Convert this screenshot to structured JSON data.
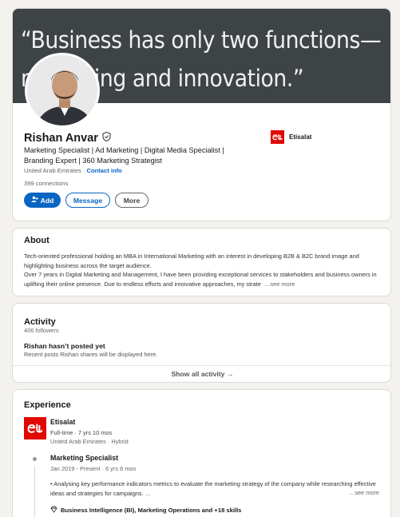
{
  "profile": {
    "banner_line_1": "“Business has only two functions—",
    "banner_line_2": "marketing and innovation.”",
    "name": "Rishan Anvar",
    "headline": "Marketing Specialist | Ad Marketing | Digital Media Specialist | Branding Expert | 360 Marketing Strategist",
    "location": "United Arab Emirates",
    "location_sep": " · ",
    "contact_info": "Contact info",
    "connections": "399 connections",
    "current_company": "Etisalat",
    "buttons": {
      "add": "Add",
      "message": "Message",
      "more": "More"
    }
  },
  "about": {
    "title": "About",
    "text_1": "Tech-oriented professional holding an MBA in International Marketing with an interest in developing B2B & B2C brand image and highlighting business across the target audience.",
    "text_2": "Over 7 years in Digital Marketing and Management, I have been providing exceptional services to stakeholders and business owners in uplifting their online presence. Due to endless efforts and innovative approaches, my strate",
    "see_more": "…see more"
  },
  "activity": {
    "title": "Activity",
    "followers": "406 followers",
    "no_posts_title": "Rishan hasn’t posted yet",
    "no_posts_sub": "Recent posts Rishan shares will be displayed here.",
    "show_all": "Show all activity →"
  },
  "experience": {
    "title": "Experience",
    "company": "Etisalat",
    "employment": "Full-time · 7 yrs 10 mos",
    "location": "United Arab Emirates · Hybrid",
    "role": "Marketing Specialist",
    "dates": "Jan 2019 - Present · 6 yrs 6 mos",
    "description": "• Analysing key performance indicators metrics to evaluate the marketing strategy of the company while researching effective ideas and strategies for campaigns. …",
    "see_more": "…see more",
    "skills": "Business Intelligence (BI), Marketing Operations and +18 skills"
  },
  "icons": {
    "verified": "verified-shield-icon",
    "add": "add-person-icon",
    "skills": "diamond-icon",
    "logo": "etisalat-logo"
  },
  "colors": {
    "primary": "#0a66c2",
    "etisalat_red": "#e00800",
    "banner_bg": "#3e4446",
    "page_bg": "#f4f2ee"
  }
}
